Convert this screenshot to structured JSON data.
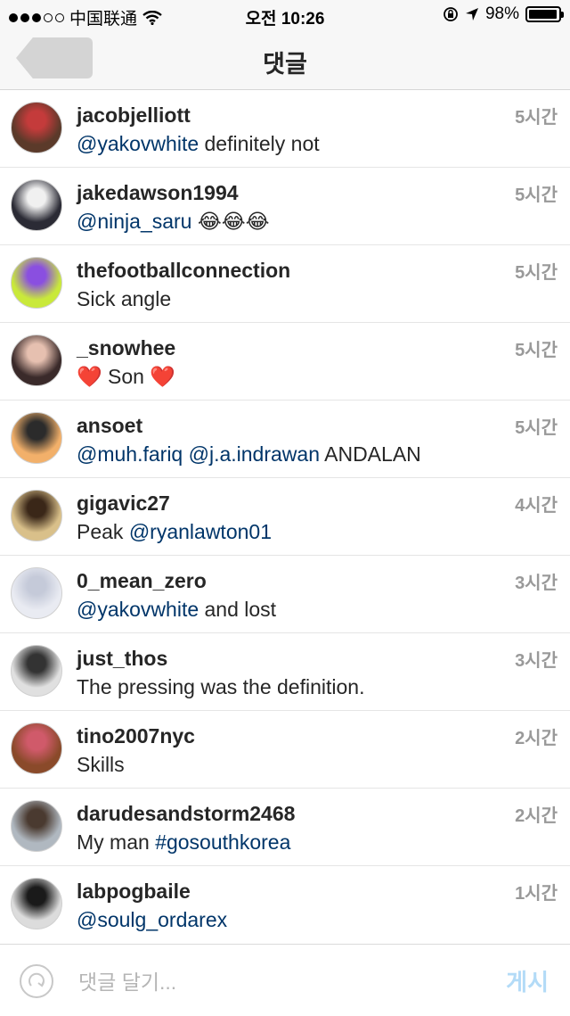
{
  "status_bar": {
    "carrier": "中国联通",
    "time": "오전 10:26",
    "battery": "98%",
    "battery_level": 0.98
  },
  "nav": {
    "title": "댓글"
  },
  "comments": [
    {
      "username": "jacobjelliott",
      "time": "5시간",
      "mention": "@yakovwhite",
      "rest": " definitely not",
      "avatar_colors": [
        "#5b3a2a",
        "#c43b3b"
      ]
    },
    {
      "username": "jakedawson1994",
      "time": "5시간",
      "mention": "@ninja_saru",
      "rest": " 😂😂😂",
      "avatar_colors": [
        "#2b2b35",
        "#f0f0f0"
      ]
    },
    {
      "username": "thefootballconnection",
      "time": "5시간",
      "prefix": "Sick angle",
      "avatar_colors": [
        "#c9e93a",
        "#8a4fe0"
      ]
    },
    {
      "username": "_snowhee",
      "time": "5시간",
      "prefix": "❤️ Son ❤️",
      "avatar_colors": [
        "#3a2a2a",
        "#e6c0b0"
      ]
    },
    {
      "username": "ansoet",
      "time": "5시간",
      "mention": "@muh.fariq",
      "rest": " ",
      "mention2": "@j.a.indrawan",
      "rest2": " ANDALAN",
      "avatar_colors": [
        "#f2b06a",
        "#2b2b2b"
      ]
    },
    {
      "username": "gigavic27",
      "time": "4시간",
      "prefix": "Peak ",
      "mention": "@ryanlawton01",
      "avatar_colors": [
        "#d9c08a",
        "#3a2718"
      ]
    },
    {
      "username": "0_mean_zero",
      "time": "3시간",
      "mention": "@yakovwhite",
      "rest": " and lost",
      "avatar_colors": [
        "#e9ebf2",
        "#c5cad9"
      ]
    },
    {
      "username": "just_thos",
      "time": "3시간",
      "prefix": "The pressing was the definition.",
      "avatar_colors": [
        "#e0e0e0",
        "#333333"
      ]
    },
    {
      "username": "tino2007nyc",
      "time": "2시간",
      "prefix": "Skills",
      "avatar_colors": [
        "#8a4a2a",
        "#d05a6a"
      ]
    },
    {
      "username": "darudesandstorm2468",
      "time": "2시간",
      "prefix": "My man ",
      "mention": "#gosouthkorea",
      "avatar_colors": [
        "#b0b8c0",
        "#4a3a30"
      ]
    },
    {
      "username": "labpogbaile",
      "time": "1시간",
      "mention": "@soulg_ordarex",
      "avatar_colors": [
        "#dcdcdc",
        "#1a1a1a"
      ]
    }
  ],
  "input_bar": {
    "placeholder": "댓글 달기...",
    "post_label": "게시",
    "refresh_icon": "refresh-icon"
  }
}
